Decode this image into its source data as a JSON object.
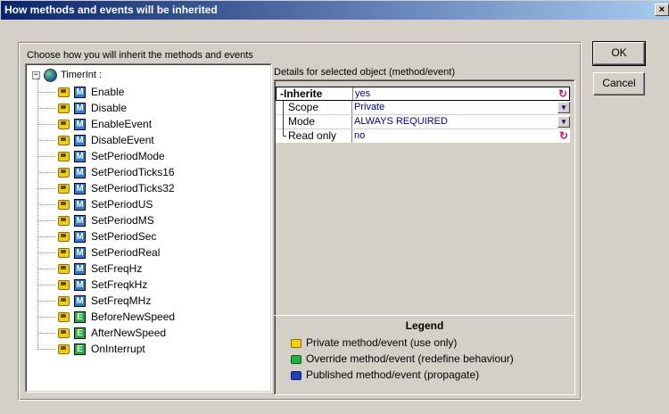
{
  "window": {
    "title": "How methods and events will be inherited",
    "close_glyph": "×"
  },
  "group": {
    "label": "Choose how you will inherit the methods and events"
  },
  "tree": {
    "root": {
      "label": "TimerInt :",
      "expander": "−",
      "icon": "globe-icon"
    },
    "items": [
      {
        "label": "Enable",
        "type": "M",
        "access": "private"
      },
      {
        "label": "Disable",
        "type": "M",
        "access": "private"
      },
      {
        "label": "EnableEvent",
        "type": "M",
        "access": "private"
      },
      {
        "label": "DisableEvent",
        "type": "M",
        "access": "private"
      },
      {
        "label": "SetPeriodMode",
        "type": "M",
        "access": "private"
      },
      {
        "label": "SetPeriodTicks16",
        "type": "M",
        "access": "private"
      },
      {
        "label": "SetPeriodTicks32",
        "type": "M",
        "access": "private"
      },
      {
        "label": "SetPeriodUS",
        "type": "M",
        "access": "private"
      },
      {
        "label": "SetPeriodMS",
        "type": "M",
        "access": "private"
      },
      {
        "label": "SetPeriodSec",
        "type": "M",
        "access": "private"
      },
      {
        "label": "SetPeriodReal",
        "type": "M",
        "access": "private"
      },
      {
        "label": "SetFreqHz",
        "type": "M",
        "access": "private"
      },
      {
        "label": "SetFreqkHz",
        "type": "M",
        "access": "private"
      },
      {
        "label": "SetFreqMHz",
        "type": "M",
        "access": "private"
      },
      {
        "label": "BeforeNewSpeed",
        "type": "E",
        "access": "private"
      },
      {
        "label": "AfterNewSpeed",
        "type": "E",
        "access": "private"
      },
      {
        "label": "OnInterrupt",
        "type": "E",
        "access": "private"
      }
    ]
  },
  "details": {
    "label": "Details for selected object (method/event)",
    "rows": [
      {
        "name": "-Inherite",
        "value": "yes",
        "control": "cycle"
      },
      {
        "name": "Scope",
        "value": "Private",
        "control": "dropdown"
      },
      {
        "name": "Mode",
        "value": "ALWAYS REQUIRED",
        "control": "dropdown"
      },
      {
        "name": "Read only",
        "value": "no",
        "control": "cycle"
      }
    ]
  },
  "legend": {
    "title": "Legend",
    "items": [
      {
        "icon": "private-icon",
        "text": "Private method/event (use only)"
      },
      {
        "icon": "override-icon",
        "text": "Override method/event (redefine behaviour)"
      },
      {
        "icon": "published-icon",
        "text": "Published method/event (propagate)"
      }
    ]
  },
  "buttons": {
    "ok": "OK",
    "cancel": "Cancel"
  }
}
